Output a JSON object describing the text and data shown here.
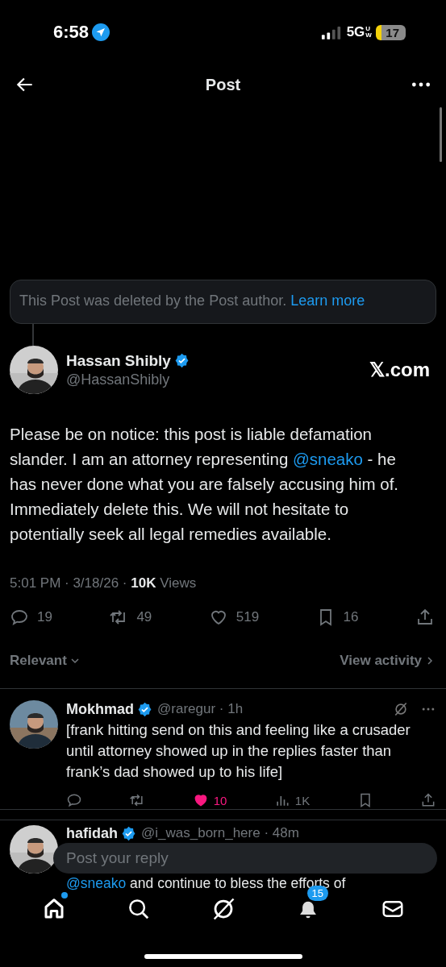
{
  "status_bar": {
    "time": "6:58",
    "network": "5G",
    "network_suffix": "UW",
    "battery": "17",
    "location_active": true
  },
  "header": {
    "title": "Post"
  },
  "deleted_notice": {
    "text": "This Post was deleted by the Post author.",
    "link": "Learn more"
  },
  "post": {
    "author": "Hassan Shibly",
    "verified": true,
    "handle": "@HassanShibly",
    "source": "𝕏.com",
    "body": "Please be on notice: this post is liable defamation slander. I am an attorney representing ",
    "mention": "@sneako",
    "body_end": " - he has never done what you are falsely accusing him of. Immediately delete this. We will not hesitate to potentially seek all legal remedies available.",
    "time": "5:01 PM · 3/18/26 · ",
    "views": "10K",
    "views_label": "Views",
    "actions": [
      {
        "kind": "reply",
        "count": "19"
      },
      {
        "kind": "repost",
        "count": "49"
      },
      {
        "kind": "like",
        "count": "519"
      },
      {
        "kind": "bookmark",
        "count": "16"
      },
      {
        "kind": "share"
      }
    ]
  },
  "sort": {
    "label": "Relevant",
    "activity": "View activity"
  },
  "replies": [
    {
      "name": "Mokhmad",
      "verified": true,
      "handle": "@raregur · 1h",
      "text": "[frank hitting send on this and feeling like a crusader until attorney showed up in the replies faster than frank’s dad showed up to his life]",
      "liked": true,
      "actions": [
        {
          "kind": "reply"
        },
        {
          "kind": "repost"
        },
        {
          "kind": "like",
          "count": "10"
        },
        {
          "kind": "views",
          "count": "1K"
        },
        {
          "kind": "bookmark"
        },
        {
          "kind": "share"
        }
      ]
    },
    {
      "name": "hafidah",
      "verified": true,
      "handle": "@i_was_born_here · 48m",
      "mention": "@sneako",
      "text": " and continue to bless the efforts of"
    }
  ],
  "reply_field": {
    "placeholder": "Post your reply"
  },
  "tab_bar": [
    {
      "kind": "home",
      "selected": true,
      "dot": true
    },
    {
      "kind": "search",
      "selected": false
    },
    {
      "kind": "grok",
      "selected": false
    },
    {
      "kind": "notifications",
      "selected": false,
      "badge": "15"
    },
    {
      "kind": "messages",
      "selected": false
    }
  ]
}
